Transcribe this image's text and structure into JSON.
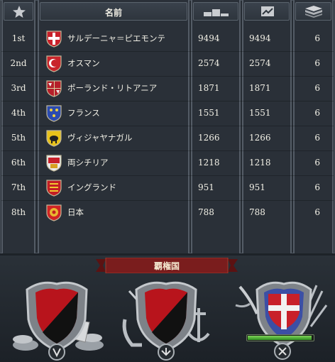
{
  "header": {
    "name_label": "名前",
    "rank_icon": "star-icon",
    "score_icon": "podium-icon",
    "history_icon": "trend-chart-icon",
    "count_icon": "stack-icon"
  },
  "rows": [
    {
      "rank": "1st",
      "name": "サルデーニャ＝ピエモンテ",
      "score": "9494",
      "history": "9494",
      "count": "6",
      "flag": "savoy-cross"
    },
    {
      "rank": "2nd",
      "name": "オスマン",
      "score": "2574",
      "history": "2574",
      "count": "6",
      "flag": "crescent"
    },
    {
      "rank": "3rd",
      "name": "ポーランド・リトアニア",
      "score": "1871",
      "history": "1871",
      "count": "6",
      "flag": "eagle-knight"
    },
    {
      "rank": "4th",
      "name": "フランス",
      "score": "1551",
      "history": "1551",
      "count": "6",
      "flag": "fleur-de-lis"
    },
    {
      "rank": "5th",
      "name": "ヴィジャヤナガル",
      "score": "1266",
      "history": "1266",
      "count": "6",
      "flag": "boar"
    },
    {
      "rank": "6th",
      "name": "両シチリア",
      "score": "1218",
      "history": "1218",
      "count": "6",
      "flag": "castle"
    },
    {
      "rank": "7th",
      "name": "イングランド",
      "score": "951",
      "history": "951",
      "count": "6",
      "flag": "lions"
    },
    {
      "rank": "8th",
      "name": "日本",
      "score": "788",
      "history": "788",
      "count": "6",
      "flag": "mon"
    }
  ],
  "hegemony": {
    "title": "覇権国",
    "slots": [
      {
        "type": "economic",
        "icon": "coins-icon",
        "badge": "economic-badge-icon"
      },
      {
        "type": "naval",
        "icon": "anchor-icon",
        "badge": "naval-badge-icon"
      },
      {
        "type": "military",
        "icon": "weapons-icon",
        "badge": "military-badge-icon",
        "progress": 0.98
      }
    ]
  },
  "colors": {
    "panel": "#2a3038",
    "border": "#545c66",
    "banner": "#7a1d1d",
    "shield_red": "#b8141c",
    "shield_black": "#111111",
    "savoy_red": "#c8202a",
    "progress_green": "#4fb133"
  }
}
